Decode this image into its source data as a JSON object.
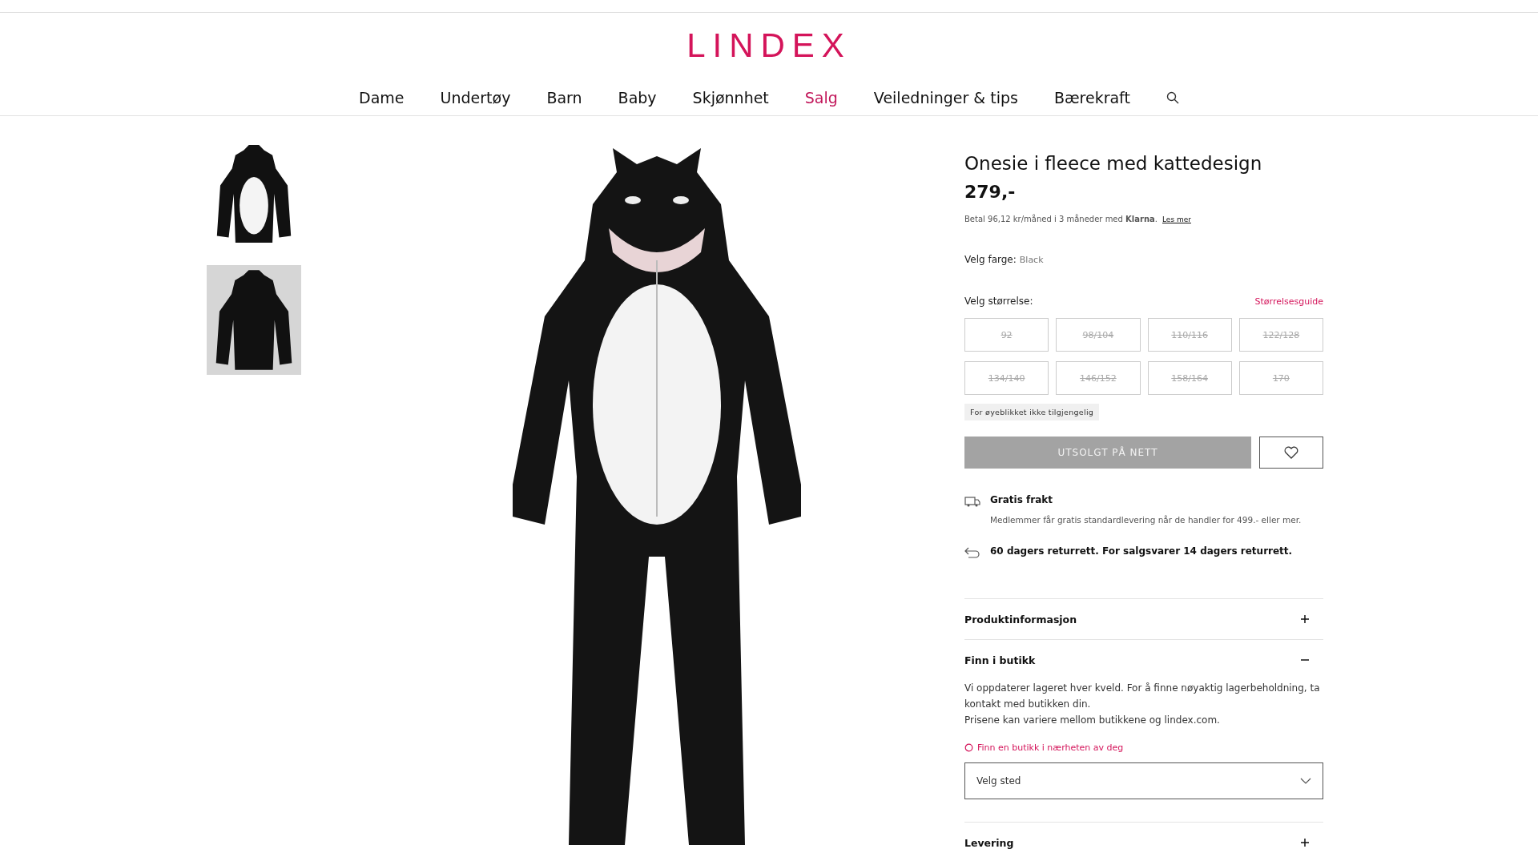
{
  "header": {
    "logo": "LINDEX",
    "nav": [
      {
        "label": "Dame",
        "selected": false
      },
      {
        "label": "Undertøy",
        "selected": false
      },
      {
        "label": "Barn",
        "selected": false
      },
      {
        "label": "Baby",
        "selected": false
      },
      {
        "label": "Skjønnhet",
        "selected": false
      },
      {
        "label": "Salg",
        "selected": true
      },
      {
        "label": "Veiledninger & tips",
        "selected": false
      },
      {
        "label": "Bærekraft",
        "selected": false
      }
    ]
  },
  "gallery": {
    "thumbnails": [
      {
        "selected": true
      },
      {
        "selected": false
      }
    ]
  },
  "product": {
    "title": "Onesie i fleece med kattedesign",
    "price": "279,-",
    "klarna": "Betal 96,12 kr/måned i 3 måneder med **Klarna**.",
    "klarna_link": "Les mer",
    "color_label": "Velg farge:",
    "color_value": "Black",
    "size_label": "Velg størrelse:",
    "size_guide": "Størrelsesguide",
    "sizes": [
      {
        "label": "92",
        "available": false
      },
      {
        "label": "98/104",
        "available": false
      },
      {
        "label": "110/116",
        "available": false
      },
      {
        "label": "122/128",
        "available": false
      },
      {
        "label": "134/140",
        "available": false
      },
      {
        "label": "146/152",
        "available": false
      },
      {
        "label": "158/164",
        "available": false
      },
      {
        "label": "170",
        "available": false
      }
    ],
    "size_notice": "For øyeblikket ikke tilgjengelig",
    "buy_button": {
      "label": "UTSOLGT PÅ NETT",
      "disabled": true
    },
    "shipping_title": "Gratis frakt",
    "shipping_text": "Medlemmer får gratis standardlevering når de handler for 499.- eller mer.",
    "returns_text": "60 dagers returrett. For salgsvarer 14 dagers returrett.",
    "accordions": [
      {
        "title": "Produktinformasjon",
        "expanded": false
      },
      {
        "title": "Finn i butikk",
        "expanded": true,
        "paragraphs": [
          "Vi oppdaterer lageret hver kveld. For å finne nøyaktig lagerbeholdning, ta kontakt med butikken din.",
          "Prisene kan variere mellom butikkene og lindex.com."
        ],
        "store_link": "Finn en butikk i nærheten av deg",
        "select": {
          "value": "Velg sted"
        }
      },
      {
        "title": "Levering",
        "expanded": false
      }
    ]
  }
}
